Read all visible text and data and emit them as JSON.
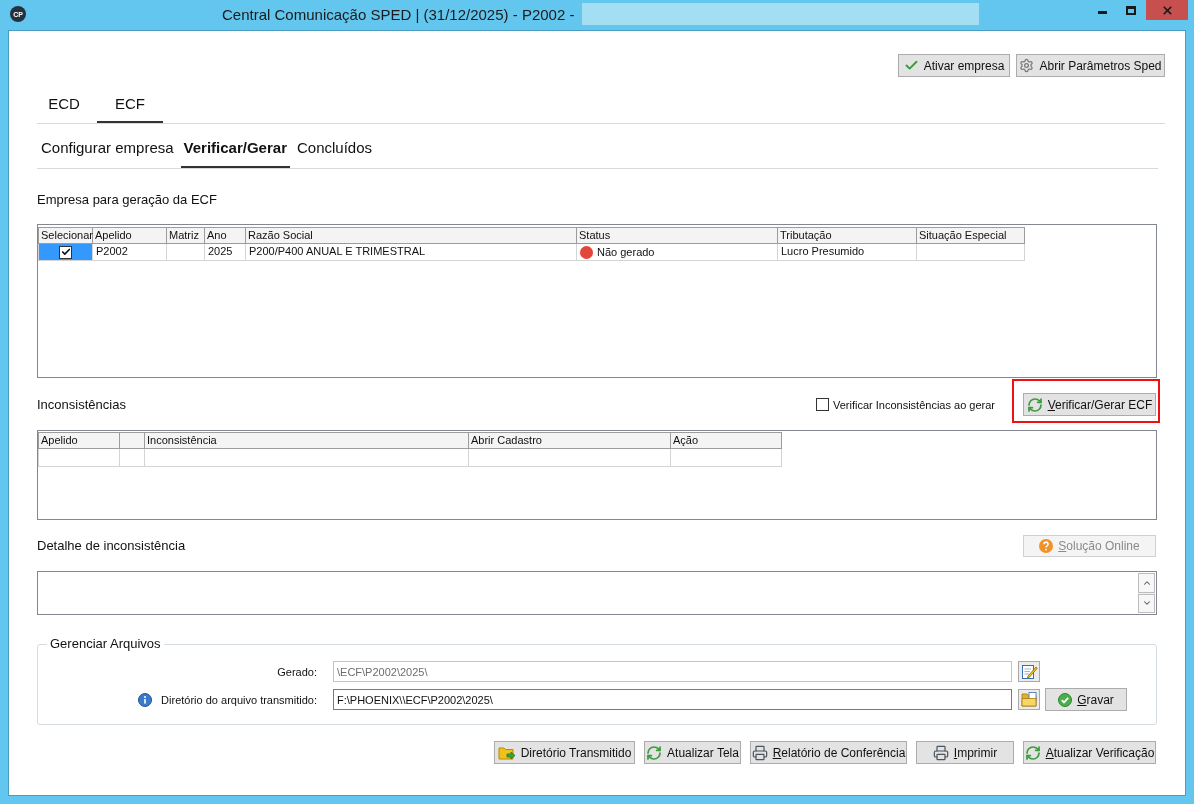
{
  "window": {
    "app_icon_text": "CP",
    "title": "Central Comunicação SPED | (31/12/2025) - P2002 -",
    "redacted": true
  },
  "toolbar_buttons": [
    {
      "label": "Ativar empresa"
    },
    {
      "label": "Abrir Parâmetros Sped"
    }
  ],
  "tabs": [
    {
      "label": "ECD",
      "selected": false
    },
    {
      "label": "ECF",
      "selected": true
    }
  ],
  "subtabs": [
    {
      "label": "Configurar empresa",
      "selected": false
    },
    {
      "label": "Verificar/Gerar",
      "selected": true
    },
    {
      "label": "Concluídos",
      "selected": false
    }
  ],
  "companies": {
    "title": "Empresa para geração da ECF",
    "columns": [
      {
        "label": "Selecionar"
      },
      {
        "label": "Apelido"
      },
      {
        "label": "Matriz"
      },
      {
        "label": "Ano"
      },
      {
        "label": "Razão Social"
      },
      {
        "label": "Status"
      },
      {
        "label": "Tributação"
      },
      {
        "label": "Situação Especial"
      }
    ],
    "rows": [
      {
        "selected": true,
        "checked": true,
        "apelido": "P2002",
        "ano": "2025",
        "razao_social": "P200/P400 ANUAL E TRIMESTRAL",
        "status": {
          "text": "Não gerado",
          "color": "#e2463a"
        },
        "tributacao": "Lucro Presumido"
      }
    ]
  },
  "inconsistencies": {
    "title": "Inconsistências",
    "verify_on_generate": {
      "label": "Verificar Inconsistências ao gerar",
      "checked": false
    },
    "generate_button": {
      "label": "Verificar/Gerar ECF",
      "mnemonic": true,
      "highlighted": true
    },
    "columns": [
      {
        "label": "Apelido"
      },
      {},
      {
        "label": "Inconsistência"
      },
      {
        "label": "Abrir Cadastro"
      },
      {
        "label": "Ação"
      }
    ]
  },
  "detail": {
    "title": "Detalhe de inconsistência",
    "online_button": {
      "label": "Solução Online",
      "mnemonic": true,
      "disabled": true
    }
  },
  "files": {
    "title": "Gerenciar Arquivos",
    "generated": {
      "label": "Gerado:",
      "value": "\\ECF\\P2002\\2025\\",
      "disabled": true
    },
    "transmitted": {
      "label": "Diretório do arquivo transmitido:",
      "value": "F:\\PHOENIX\\\\ECF\\P2002\\2025\\",
      "disabled": false
    },
    "save_button": {
      "label": "Gravar",
      "mnemonic": true
    }
  },
  "footer_buttons": [
    {
      "label": "Diretório Transmitido",
      "mnemonic": false
    },
    {
      "label": "Atualizar Tela",
      "mnemonic": false
    },
    {
      "label": "Relatório de Conferência",
      "mnemonic": true
    },
    {
      "label": "Imprimir",
      "mnemonic": true
    },
    {
      "label": "Atualizar Verificação",
      "mnemonic": true
    }
  ]
}
